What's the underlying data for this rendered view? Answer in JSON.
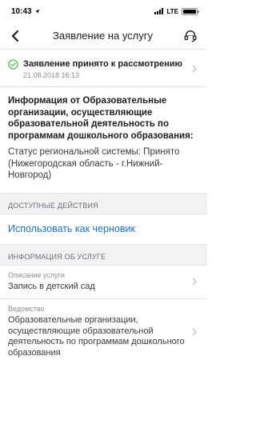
{
  "status_bar": {
    "time": "10:43",
    "network": "LTE",
    "location_icon": "location-arrow-icon"
  },
  "nav": {
    "title": "Заявление на услугу",
    "back_icon": "chevron-left-icon",
    "support_icon": "headset-icon"
  },
  "application_status": {
    "title": "Заявление принято к рассмотрению",
    "date": "21.08.2018 16:13",
    "icon": "check-circle-icon",
    "icon_color": "#4cba4f"
  },
  "info": {
    "heading": "Информация от Образовательные организации, осуществляющие образовательной деятельность по программам дошкольного образования:",
    "status_text": "Статус региональной системы: Принято (Нижегородская область - г.Нижний-Новгород)"
  },
  "actions": {
    "header": "ДОСТУПНЫЕ ДЕЙСТВИЯ",
    "use_as_draft": "Использовать как черновик",
    "link_color": "#1a73c9"
  },
  "service_info": {
    "header": "ИНФОРМАЦИЯ ОБ УСЛУГЕ",
    "rows": [
      {
        "label": "Описание услуги",
        "value": "Запись в детский сад"
      },
      {
        "label": "Ведомство",
        "value": "Образовательные организации, осуществляющие образовательной деятельность по программам дошкольного образования"
      }
    ]
  }
}
